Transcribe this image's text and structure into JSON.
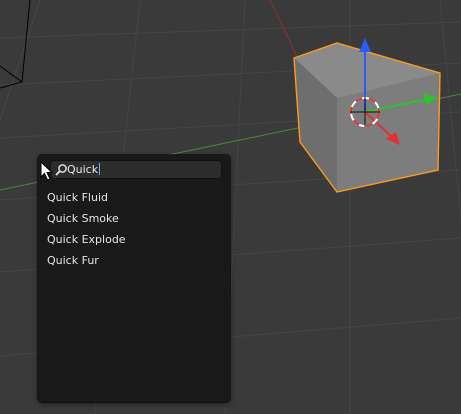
{
  "search": {
    "query": "Quick"
  },
  "results": [
    {
      "label": "Quick Fluid"
    },
    {
      "label": "Quick Smoke"
    },
    {
      "label": "Quick Explode"
    },
    {
      "label": "Quick Fur"
    }
  ],
  "icons": {
    "search": "magnifier-icon",
    "pointer": "mouse-pointer-icon",
    "manipulator": "transform-manipulator-icon"
  },
  "colors": {
    "viewport_bg": "#3a3a3a",
    "grid_line": "#454545",
    "axis_x": "#8b2f2f",
    "axis_y": "#4f8a2f",
    "selection_outline": "#ff9a1e",
    "cube_top": "#8a8a8a",
    "cube_front": "#7d7d7d",
    "cube_side": "#6e6e6e",
    "gizmo_z": "#2a5cff",
    "gizmo_y": "#2ec22e",
    "gizmo_x": "#e03030",
    "popup_bg": "#191919",
    "field_bg": "#2c2c2c",
    "text": "#e6e6e6"
  }
}
